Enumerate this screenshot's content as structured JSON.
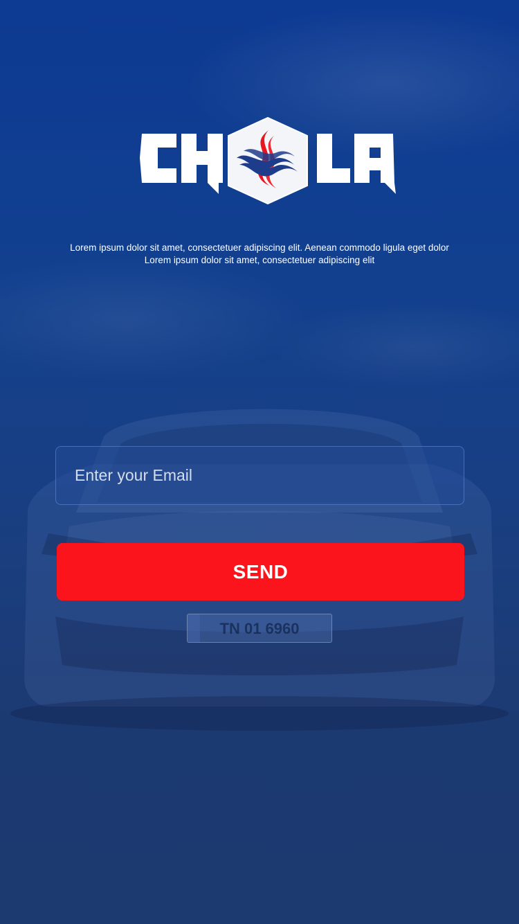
{
  "brand": {
    "logo_text": "CHOLA",
    "colors": {
      "primary_blue": "#1b3f86",
      "accent_red": "#fb141b",
      "logo_blue": "#1e3c8c",
      "logo_red": "#e8141e"
    }
  },
  "tagline": {
    "line1": "Lorem ipsum dolor sit amet, consectetuer adipiscing elit. Aenean commodo ligula eget dolor",
    "line2": "Lorem ipsum dolor sit amet, consectetuer adipiscing elit"
  },
  "form": {
    "email_placeholder": "Enter your Email",
    "email_value": "",
    "send_label": "SEND"
  },
  "background": {
    "plate_text": "TN 01 6960"
  }
}
